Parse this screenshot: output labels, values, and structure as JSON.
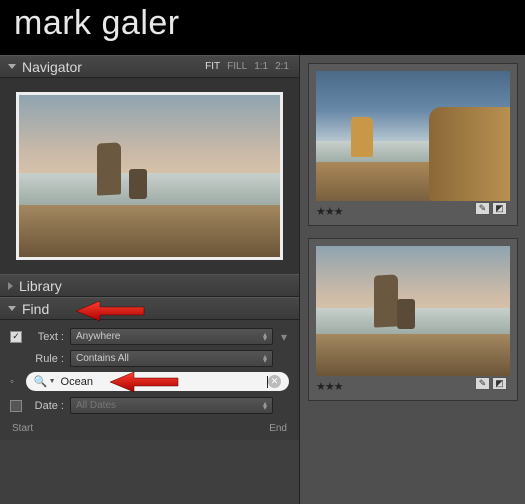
{
  "header": {
    "first": "mark",
    "last": "galer"
  },
  "navigator": {
    "title": "Navigator",
    "zoom": [
      "FIT",
      "FILL",
      "1:1",
      "2:1"
    ],
    "active": "FIT"
  },
  "library": {
    "title": "Library"
  },
  "find": {
    "title": "Find",
    "text_checked": "✓",
    "text_label": "Text :",
    "text_scope": "Anywhere",
    "rule_label": "Rule :",
    "rule_value": "Contains All",
    "search_value": "Ocean",
    "date_label": "Date :",
    "date_value": "All Dates",
    "start": "Start",
    "end": "End"
  },
  "thumbs": [
    {
      "rating": "★★★"
    },
    {
      "rating": "★★★"
    }
  ]
}
